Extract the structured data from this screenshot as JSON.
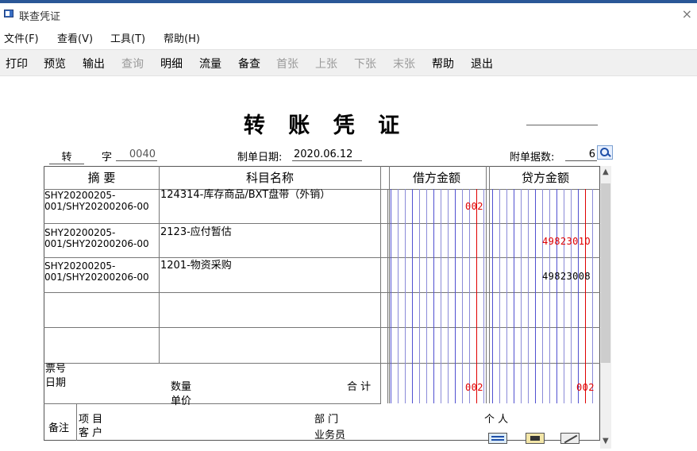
{
  "window": {
    "title": "联查凭证",
    "close_glyph": "×"
  },
  "menu": [
    "文件(F)",
    "查看(V)",
    "工具(T)",
    "帮助(H)"
  ],
  "toolbar": [
    {
      "label": "打印",
      "enabled": true
    },
    {
      "label": "预览",
      "enabled": true
    },
    {
      "label": "输出",
      "enabled": true
    },
    {
      "label": "查询",
      "enabled": false
    },
    {
      "label": "明细",
      "enabled": true
    },
    {
      "label": "流量",
      "enabled": true
    },
    {
      "label": "备查",
      "enabled": true
    },
    {
      "label": "首张",
      "enabled": false
    },
    {
      "label": "上张",
      "enabled": false
    },
    {
      "label": "下张",
      "enabled": false
    },
    {
      "label": "末张",
      "enabled": false
    },
    {
      "label": "帮助",
      "enabled": true
    },
    {
      "label": "退出",
      "enabled": true
    }
  ],
  "voucher": {
    "title": "转 账 凭 证",
    "type": "转",
    "word_label": "字",
    "number": "0040",
    "date_label": "制单日期:",
    "date": "2020.06.12",
    "attach_label": "附单据数:",
    "attach_count": "6",
    "columns": {
      "summary": "摘 要",
      "account": "科目名称",
      "debit": "借方金额",
      "credit": "贷方金额"
    },
    "rows": [
      {
        "summary_1": "SHY20200205-",
        "summary_2": "001/SHY20200206-00",
        "account": "124314-库存商品/BXT盘带（外销）",
        "debit": "002",
        "credit": ""
      },
      {
        "summary_1": "SHY20200205-",
        "summary_2": "001/SHY20200206-00",
        "account": "2123-应付暂估",
        "debit": "",
        "credit": "4982301O"
      },
      {
        "summary_1": "SHY20200205-",
        "summary_2": "001/SHY20200206-00",
        "account": "1201-物资采购",
        "debit": "",
        "credit": "49823008"
      }
    ],
    "footer": {
      "ticket_label": "票号",
      "date_label": "日期",
      "qty_label": "数量",
      "price_label": "单价",
      "total_label": "合 计",
      "total_debit": "002",
      "total_credit": "002"
    },
    "remarks": {
      "label": "备注",
      "project_label": "项  目",
      "customer_label": "客  户",
      "dept_label": "部  门",
      "salesman_label": "业务员",
      "person_label": "个  人"
    }
  }
}
